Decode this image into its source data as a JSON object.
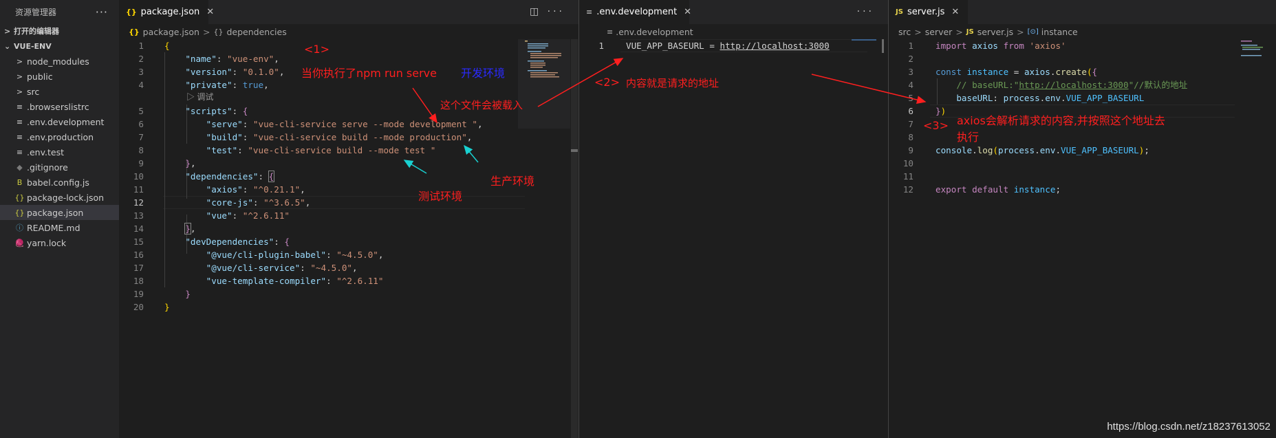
{
  "sidebar": {
    "title": "资源管理器",
    "more": "···",
    "open_editors": "打开的编辑器",
    "project": "VUE-ENV",
    "items": [
      {
        "label": "node_modules",
        "icon": ">",
        "kind": "folder"
      },
      {
        "label": "public",
        "icon": ">",
        "kind": "folder"
      },
      {
        "label": "src",
        "icon": ">",
        "kind": "folder"
      },
      {
        "label": ".browserslistrc",
        "icon": "≡",
        "kind": "file"
      },
      {
        "label": ".env.development",
        "icon": "≡",
        "kind": "file"
      },
      {
        "label": ".env.production",
        "icon": "≡",
        "kind": "file"
      },
      {
        "label": ".env.test",
        "icon": "≡",
        "kind": "file"
      },
      {
        "label": ".gitignore",
        "icon": "◆",
        "kind": "file"
      },
      {
        "label": "babel.config.js",
        "icon": "B",
        "kind": "file"
      },
      {
        "label": "package-lock.json",
        "icon": "{}",
        "kind": "file"
      },
      {
        "label": "package.json",
        "icon": "{}",
        "kind": "file",
        "active": true
      },
      {
        "label": "README.md",
        "icon": "ⓘ",
        "kind": "file"
      },
      {
        "label": "yarn.lock",
        "icon": "🧶",
        "kind": "file"
      }
    ]
  },
  "editor1": {
    "tab": {
      "icon": "{}",
      "label": "package.json",
      "close": "✕"
    },
    "actions": "◫ ···",
    "breadcrumb": {
      "file_icon": "{}",
      "file": "package.json",
      "sym_icon": "{}",
      "symbol": "dependencies"
    },
    "line_numbers": [
      "1",
      "2",
      "3",
      "4",
      "5",
      "6",
      "7",
      "8",
      "9",
      "10",
      "11",
      "12",
      "13",
      "14",
      "15",
      "16",
      "17",
      "18",
      "19",
      "20"
    ],
    "codelens": "调试"
  },
  "editor2": {
    "tab": {
      "icon": "≡",
      "label": ".env.development",
      "close": "✕"
    },
    "actions": "···",
    "breadcrumb": {
      "file_icon": "≡",
      "file": ".env.development"
    },
    "line_numbers": [
      "1"
    ],
    "line": {
      "key": "VUE_APP_BASEURL",
      "eq": " = ",
      "value": "http://localhost:3000"
    }
  },
  "editor3": {
    "tab": {
      "icon": "JS",
      "label": "server.js",
      "close": "✕"
    },
    "breadcrumb": {
      "p1": "src",
      "p2": "server",
      "file_icon": "JS",
      "file": "server.js",
      "sym_icon": "[⊙]",
      "symbol": "instance"
    },
    "line_numbers": [
      "1",
      "2",
      "3",
      "4",
      "5",
      "6",
      "7",
      "8",
      "9",
      "10",
      "11",
      "12"
    ]
  },
  "annotations": {
    "n1": "<1>",
    "t1": "当你执行了npm run serve",
    "t1_blue": "开发环境",
    "loaded": "这个文件会被载入",
    "prod": "生产环境",
    "test": "测试环境",
    "n2": "<2>",
    "t2": "内容就是请求的地址",
    "n3": "<3>",
    "t3a": "axios会解析请求的内容,并按照这个地址去",
    "t3b": "执行",
    "watermark": "https://blog.csdn.net/z18237613052"
  },
  "colors": {
    "annotation": "#ff1f1f",
    "annotation_blue": "#2a2aff",
    "background": "#1e1e1e",
    "sidebar": "#252526"
  }
}
